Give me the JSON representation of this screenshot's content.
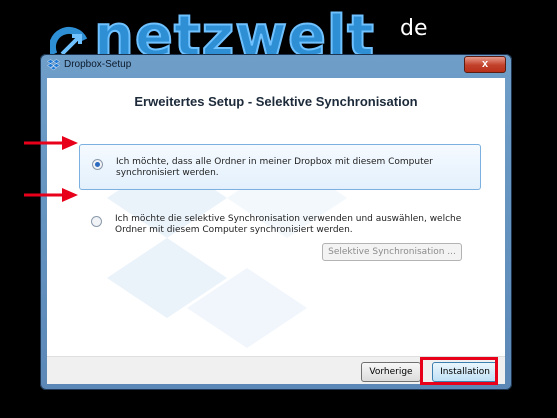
{
  "logo": {
    "brand": "netzwelt",
    "tld": "de"
  },
  "window": {
    "title": "Dropbox-Setup",
    "close_glyph": "x"
  },
  "heading": "Erweitertes Setup - Selektive Synchronisation",
  "options": [
    {
      "text": "Ich möchte, dass alle Ordner in meiner Dropbox mit diesem Computer synchronisiert werden.",
      "selected": true
    },
    {
      "text": "Ich möchte die selektive Synchronisation verwenden und auswählen, welche Ordner mit diesem Computer synchronisiert werden.",
      "selected": false
    }
  ],
  "selective_button": "Selektive Synchronisation ...",
  "buttons": {
    "back": "Vorherige",
    "install": "Installation"
  },
  "colors": {
    "annotation_red": "#e8001a",
    "logo_blue": "#2e8fd4"
  },
  "icons": {
    "title": "dropbox-icon",
    "arrow": "red-arrow-icon"
  }
}
